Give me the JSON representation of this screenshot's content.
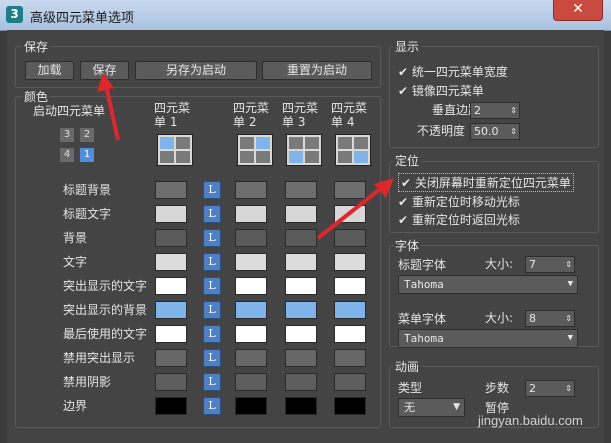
{
  "window": {
    "title": "高级四元菜单选项",
    "app_icon": "3",
    "close_glyph": "✕"
  },
  "save_group": {
    "label": "保存",
    "buttons": [
      "加载",
      "保存",
      "另存为启动",
      "重置为启动"
    ]
  },
  "color_group": {
    "label": "颜色",
    "startup_label": "启动四元菜单",
    "tiles": [
      "3",
      "2",
      "4",
      "1"
    ],
    "quad_headers": [
      "四元菜\n单 1",
      "四元菜\n单 2",
      "四元菜\n单 3",
      "四元菜\n单 4"
    ],
    "l_label": "L",
    "rows": [
      {
        "label": "标题背景",
        "colors": [
          "#6e6e6e",
          "#6e6e6e",
          "#6e6e6e",
          "#6e6e6e"
        ]
      },
      {
        "label": "标题文字",
        "colors": [
          "#d7d7d7",
          "#d7d7d7",
          "#d7d7d7",
          "#d7d7d7"
        ]
      },
      {
        "label": "背景",
        "colors": [
          "#5a5a5a",
          "#5a5a5a",
          "#5a5a5a",
          "#5a5a5a"
        ]
      },
      {
        "label": "文字",
        "colors": [
          "#dcdcdc",
          "#dcdcdc",
          "#dcdcdc",
          "#dcdcdc"
        ]
      },
      {
        "label": "突出显示的文字",
        "colors": [
          "#ffffff",
          "#ffffff",
          "#ffffff",
          "#ffffff"
        ]
      },
      {
        "label": "突出显示的背景",
        "colors": [
          "#7eb4ea",
          "#7eb4ea",
          "#7eb4ea",
          "#7eb4ea"
        ]
      },
      {
        "label": "最后使用的文字",
        "colors": [
          "#ffffff",
          "#ffffff",
          "#ffffff",
          "#ffffff"
        ]
      },
      {
        "label": "禁用突出显示",
        "colors": [
          "#666666",
          "#666666",
          "#666666",
          "#666666"
        ]
      },
      {
        "label": "禁用阴影",
        "colors": [
          "#5e5e5e",
          "#5e5e5e",
          "#5e5e5e",
          "#5e5e5e"
        ]
      },
      {
        "label": "边界",
        "colors": [
          "#000000",
          "#000000",
          "#000000",
          "#000000"
        ]
      }
    ]
  },
  "display_group": {
    "label": "显示",
    "checks": [
      "统一四元菜单宽度",
      "镜像四元菜单"
    ],
    "vertical_margin_label": "垂直边距",
    "vertical_margin_value": "2",
    "opacity_label": "不透明度",
    "opacity_value": "50.0"
  },
  "position_group": {
    "label": "定位",
    "checks": [
      "关闭屏幕时重新定位四元菜单",
      "重新定位时移动光标",
      "重新定位时返回光标"
    ]
  },
  "font_group": {
    "label": "字体",
    "title_font_label": "标题字体",
    "size_label": "大小:",
    "title_size": "7",
    "title_font": "Tahoma",
    "menu_font_label": "菜单字体",
    "menu_size": "8",
    "menu_font": "Tahoma"
  },
  "anim_group": {
    "label": "动画",
    "type_label": "类型",
    "type_value": "无",
    "steps_label": "步数",
    "steps_value": "2",
    "pause_label": "暂停"
  },
  "watermark": "jingyan.baidu.com",
  "colors": {
    "accent_blue": "#4f7fc3",
    "close_red": "#c94a3e",
    "arrow_red": "#e0262b"
  }
}
